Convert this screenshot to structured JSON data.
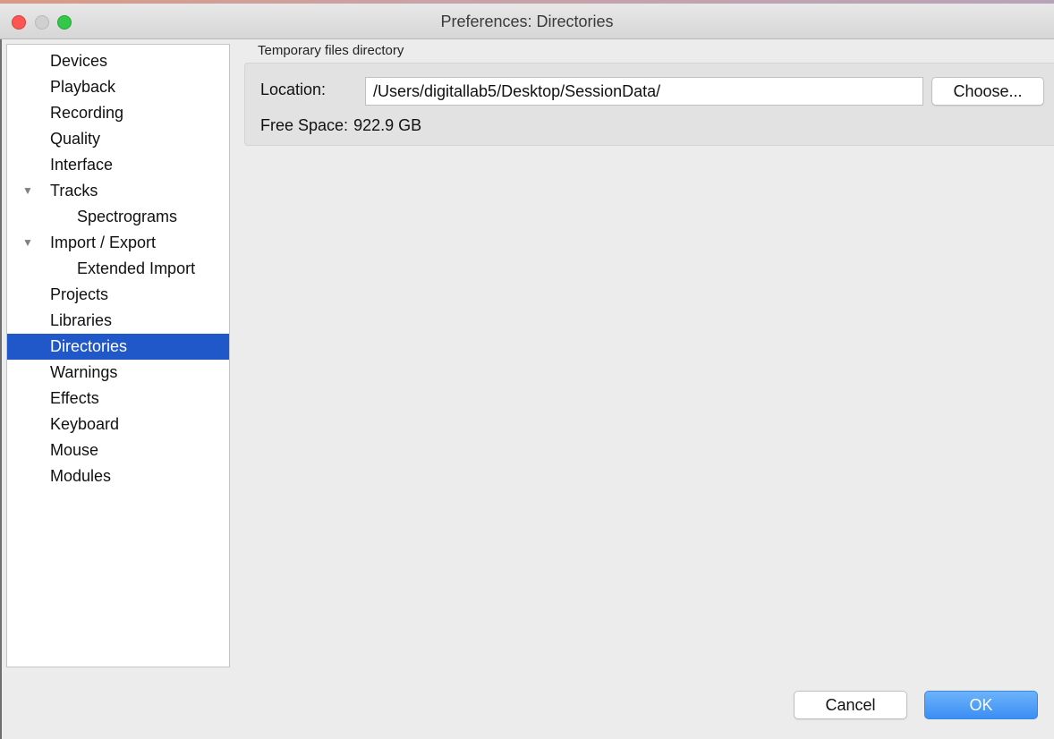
{
  "window": {
    "title": "Preferences: Directories"
  },
  "sidebar": {
    "items": [
      {
        "label": "Devices",
        "level": 0,
        "expander": "",
        "selected": false
      },
      {
        "label": "Playback",
        "level": 0,
        "expander": "",
        "selected": false
      },
      {
        "label": "Recording",
        "level": 0,
        "expander": "",
        "selected": false
      },
      {
        "label": "Quality",
        "level": 0,
        "expander": "",
        "selected": false
      },
      {
        "label": "Interface",
        "level": 0,
        "expander": "",
        "selected": false
      },
      {
        "label": "Tracks",
        "level": 0,
        "expander": "▼",
        "selected": false
      },
      {
        "label": "Spectrograms",
        "level": 1,
        "expander": "",
        "selected": false
      },
      {
        "label": "Import / Export",
        "level": 0,
        "expander": "▼",
        "selected": false
      },
      {
        "label": "Extended Import",
        "level": 1,
        "expander": "",
        "selected": false
      },
      {
        "label": "Projects",
        "level": 0,
        "expander": "",
        "selected": false
      },
      {
        "label": "Libraries",
        "level": 0,
        "expander": "",
        "selected": false
      },
      {
        "label": "Directories",
        "level": 0,
        "expander": "",
        "selected": true
      },
      {
        "label": "Warnings",
        "level": 0,
        "expander": "",
        "selected": false
      },
      {
        "label": "Effects",
        "level": 0,
        "expander": "",
        "selected": false
      },
      {
        "label": "Keyboard",
        "level": 0,
        "expander": "",
        "selected": false
      },
      {
        "label": "Mouse",
        "level": 0,
        "expander": "",
        "selected": false
      },
      {
        "label": "Modules",
        "level": 0,
        "expander": "",
        "selected": false
      }
    ]
  },
  "main": {
    "section_title": "Temporary files directory",
    "location_label": "Location:",
    "location_value": "/Users/digitallab5/Desktop/SessionData/",
    "choose_label": "Choose...",
    "free_space_label": "Free Space:",
    "free_space_value": "922.9 GB"
  },
  "footer": {
    "cancel_label": "Cancel",
    "ok_label": "OK"
  },
  "colors": {
    "selection": "#2058c9",
    "ok_button": "#3c8ef5",
    "close": "#fc5753",
    "zoom": "#34c84a"
  }
}
